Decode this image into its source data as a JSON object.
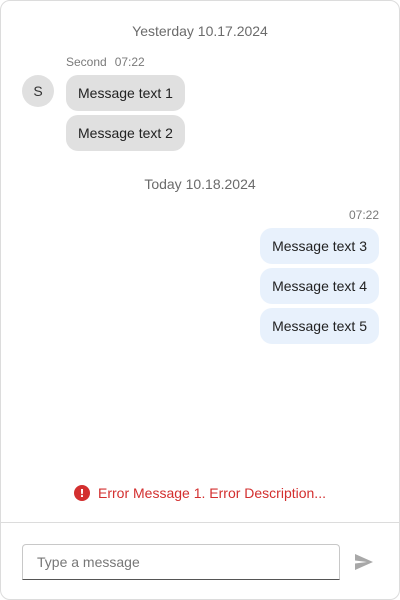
{
  "thread": {
    "days": [
      {
        "label": "Yesterday 10.17.2024",
        "groups": [
          {
            "direction": "incoming",
            "sender": "Second",
            "avatar_initial": "S",
            "time": "07:22",
            "messages": [
              "Message text 1",
              "Message text 2"
            ]
          }
        ]
      },
      {
        "label": "Today 10.18.2024",
        "groups": [
          {
            "direction": "outgoing",
            "time": "07:22",
            "messages": [
              "Message text 3",
              "Message text 4",
              "Message text 5"
            ]
          }
        ]
      }
    ]
  },
  "error": {
    "icon": "error-icon",
    "icon_glyph": "!",
    "text": "Error Message 1. Error Description..."
  },
  "composer": {
    "placeholder": "Type a message",
    "value": "",
    "send_icon": "send-icon"
  },
  "colors": {
    "incoming_bubble": "#e0e0e0",
    "outgoing_bubble": "#e8f1fc",
    "error": "#d32f2f",
    "send_icon": "#a8a8a8"
  }
}
